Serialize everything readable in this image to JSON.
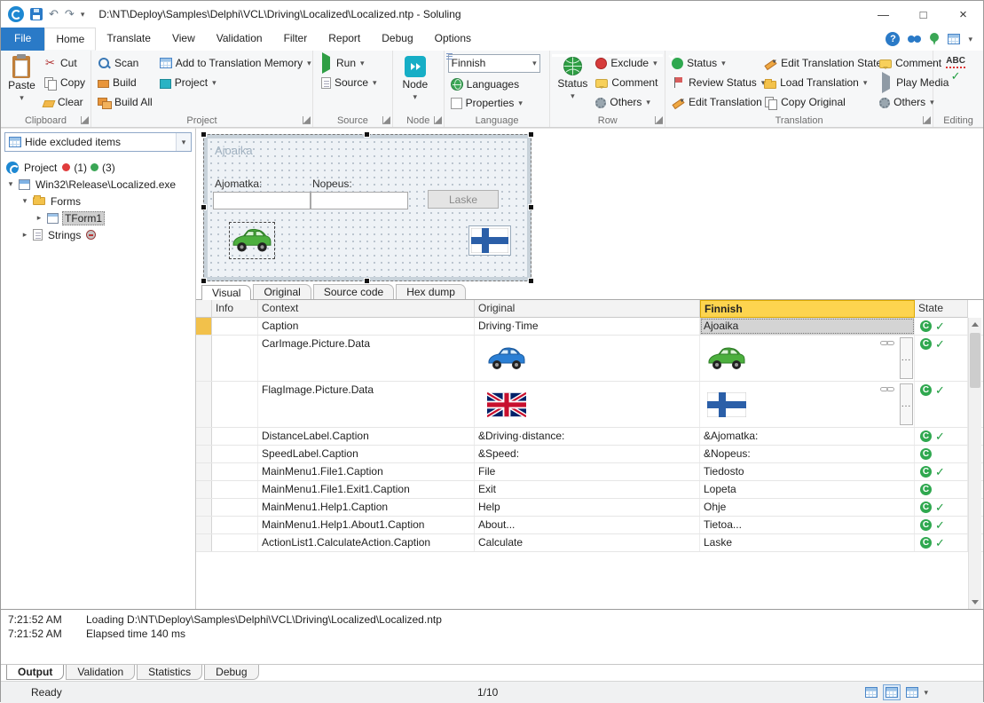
{
  "titlebar": {
    "title": "D:\\NT\\Deploy\\Samples\\Delphi\\VCL\\Driving\\Localized\\Localized.ntp - Soluling"
  },
  "icons": {
    "dropdown": "▾",
    "check": "✓",
    "undo": "↶",
    "redo": "↷",
    "minimize": "—",
    "maximize": "□",
    "close": "×",
    "help": "?",
    "expand": "▸",
    "collapse": "▾",
    "scissors": "✂",
    "abc": "ABC"
  },
  "ribbon_tabs": [
    "File",
    "Home",
    "Translate",
    "View",
    "Validation",
    "Filter",
    "Report",
    "Debug",
    "Options"
  ],
  "active_ribbon_tab": "Home",
  "ribbon": {
    "clipboard": {
      "group_label": "Clipboard",
      "paste": "Paste",
      "cut": "Cut",
      "copy": "Copy",
      "clear": "Clear"
    },
    "project": {
      "group_label": "Project",
      "scan": "Scan",
      "build": "Build",
      "build_all": "Build All",
      "add_to_tm": "Add to Translation Memory",
      "project": "Project"
    },
    "source": {
      "group_label": "Source",
      "run": "Run",
      "source": "Source"
    },
    "node": {
      "group_label": "Node",
      "node": "Node"
    },
    "language": {
      "group_label": "Language",
      "selected_language": "Finnish",
      "languages": "Languages",
      "properties": "Properties"
    },
    "row": {
      "group_label": "Row",
      "status": "Status",
      "exclude": "Exclude",
      "comment": "Comment",
      "others": "Others"
    },
    "translation": {
      "group_label": "Translation",
      "status": "Status",
      "review_status": "Review Status",
      "edit_translation": "Edit Translation",
      "edit_translation_state": "Edit Translation State",
      "load_translation": "Load Translation",
      "copy_original": "Copy Original",
      "comment": "Comment",
      "play_media": "Play Media",
      "others": "Others"
    },
    "editing": {
      "group_label": "Editing"
    }
  },
  "sidebar": {
    "filter_value": "Hide excluded items",
    "tree": [
      {
        "label": "Project",
        "badge1": "(1)",
        "badge2": "(3)"
      },
      {
        "label": "Win32\\Release\\Localized.exe"
      },
      {
        "label": "Forms"
      },
      {
        "label": "TForm1",
        "selected": true
      },
      {
        "label": "Strings",
        "excluded": true
      }
    ]
  },
  "form_preview": {
    "caption": "Ajoaika",
    "distance_label": "Ajomatka:",
    "speed_label": "Nopeus:",
    "calculate_button": "Laske"
  },
  "view_tabs": [
    "Visual",
    "Original",
    "Source code",
    "Hex dump"
  ],
  "active_view_tab": "Visual",
  "grid": {
    "headers": {
      "info": "Info",
      "context": "Context",
      "original": "Original",
      "translation": "Finnish",
      "state": "State"
    },
    "state_letter": "C",
    "ellipsis_button": "...",
    "rows": [
      {
        "context": "Caption",
        "original": "Driving·Time",
        "translation": "Ajoaika",
        "checked": true,
        "selected": true
      },
      {
        "context": "CarImage.Picture.Data",
        "original": "[blue car image]",
        "translation": "[green car image]",
        "checked": true,
        "image": true
      },
      {
        "context": "FlagImage.Picture.Data",
        "original": "[UK flag image]",
        "translation": "[Finnish flag image]",
        "checked": true,
        "image": true
      },
      {
        "context": "DistanceLabel.Caption",
        "original": "&Driving·distance:",
        "translation": "&Ajomatka:",
        "checked": true
      },
      {
        "context": "SpeedLabel.Caption",
        "original": "&Speed:",
        "translation": "&Nopeus:",
        "checked": false
      },
      {
        "context": "MainMenu1.File1.Caption",
        "original": "File",
        "translation": "Tiedosto",
        "checked": true
      },
      {
        "context": "MainMenu1.File1.Exit1.Caption",
        "original": "Exit",
        "translation": "Lopeta",
        "checked": false
      },
      {
        "context": "MainMenu1.Help1.Caption",
        "original": "Help",
        "translation": "Ohje",
        "checked": true
      },
      {
        "context": "MainMenu1.Help1.About1.Caption",
        "original": "About...",
        "translation": "Tietoa...",
        "checked": true
      },
      {
        "context": "ActionList1.CalculateAction.Caption",
        "original": "Calculate",
        "translation": "Laske",
        "checked": true
      }
    ]
  },
  "output": {
    "lines": [
      {
        "time": "7:21:52 AM",
        "message": "Loading D:\\NT\\Deploy\\Samples\\Delphi\\VCL\\Driving\\Localized\\Localized.ntp"
      },
      {
        "time": "7:21:52 AM",
        "message": "Elapsed time 140 ms"
      }
    ]
  },
  "bottom_tabs": [
    "Output",
    "Validation",
    "Statistics",
    "Debug"
  ],
  "active_bottom_tab": "Output",
  "statusbar": {
    "status": "Ready",
    "row_position": "1/10"
  },
  "colors": {
    "accent_blue": "#2a7ac7",
    "finnish_header": "#fdd44f",
    "state_green": "#2fa84f",
    "marker_yellow": "#f2c14b"
  }
}
